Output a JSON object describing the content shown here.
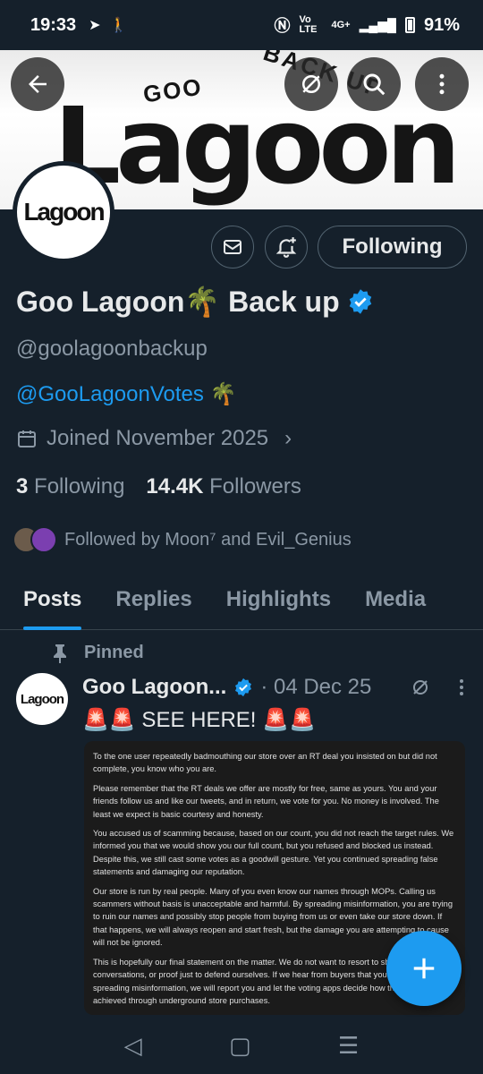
{
  "status_bar": {
    "time": "19:33",
    "network": "4G+",
    "volte": "Vo LTE",
    "battery": "91%"
  },
  "banner": {
    "title_main": "Lagoon",
    "title_top": "GOO",
    "title_arc": "BACK UP"
  },
  "profile": {
    "avatar_text": "Lagoon",
    "following_button": "Following",
    "display_name": "Goo Lagoon🌴 Back up",
    "handle": "@goolagoonbackup",
    "bio_link": "@GooLagoonVotes 🌴",
    "joined": "Joined November 2025",
    "following_count": "3",
    "following_label": "Following",
    "followers_count": "14.4K",
    "followers_label": "Followers",
    "followed_by": "Followed by Moon⁷ and Evil_Genius"
  },
  "tabs": [
    "Posts",
    "Replies",
    "Highlights",
    "Media"
  ],
  "post": {
    "pinned_label": "Pinned",
    "author": "Goo Lagoon...",
    "date": "· 04 Dec 25",
    "text": "🚨🚨 SEE HERE! 🚨🚨",
    "avatar_text": "Lagoon",
    "image_paragraphs": [
      "To the one user repeatedly badmouthing our store over an RT deal you insisted on but did not complete, you know who you are.",
      "Please remember that the RT deals we offer are mostly for free, same as yours. You and your friends follow us and like our tweets, and in return, we vote for you. No money is involved. The least we expect is basic courtesy and honesty.",
      "You accused us of scamming because, based on our count, you did not reach the target rules. We informed you that we would show you our full count, but you refused and blocked us instead. Despite this, we still cast some votes as a goodwill gesture. Yet you continued spreading false statements and damaging our reputation.",
      "Our store is run by real people. Many of you even know our names through MOPs. Calling us scammers without basis is unacceptable and harmful. By spreading misinformation, you are trying to ruin our names and possibly stop people from buying from us or even take our store down. If that happens, we will always reopen and start fresh, but the damage you are attempting to cause will not be ignored.",
      "This is hopefully our final statement on the matter. We do not want to resort to sharing private conversations, or proof just to defend ourselves. If we hear from buyers that you continue spreading misinformation, we will report you and let the voting apps decide how they view wins achieved through underground store purchases."
    ]
  },
  "colors": {
    "background": "#15202b",
    "accent": "#1d9bf0",
    "muted": "#8b98a5"
  }
}
